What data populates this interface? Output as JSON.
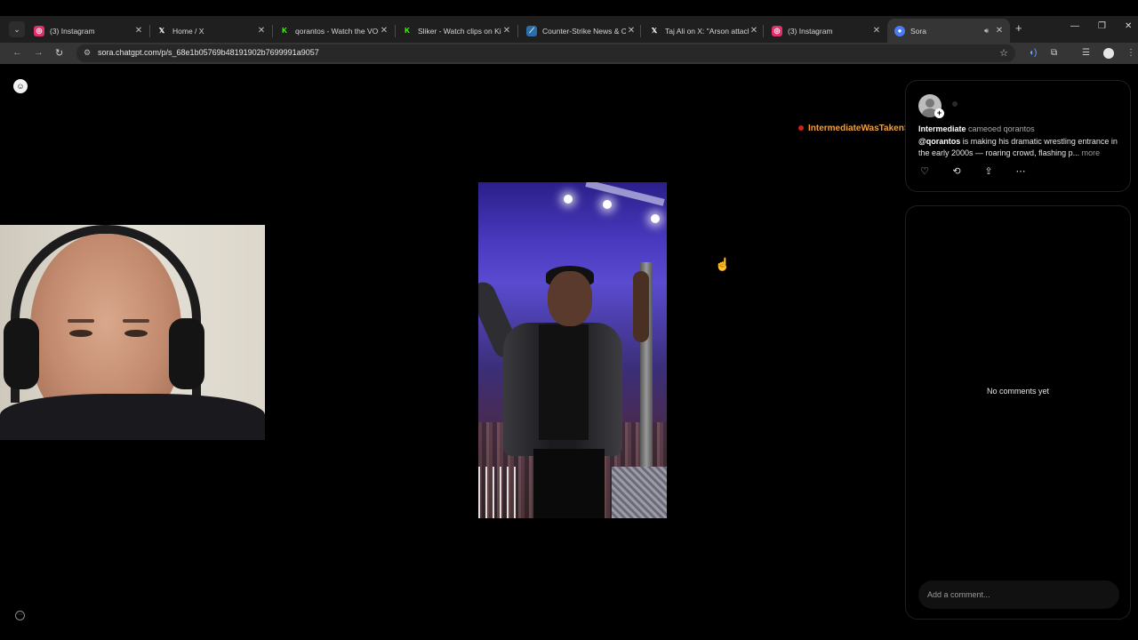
{
  "browser": {
    "tabs": [
      {
        "title": "(3) Instagram",
        "icon": "instagram-icon",
        "icon_color": "#e1306c"
      },
      {
        "title": "Home / X",
        "icon": "x-icon",
        "icon_color": "#1f1f1f"
      },
      {
        "title": "qorantos - Watch the VOD",
        "icon": "kick-icon",
        "icon_color": "#53fc18"
      },
      {
        "title": "Sliker - Watch clips on Kick",
        "icon": "kick-icon",
        "icon_color": "#53fc18"
      },
      {
        "title": "Counter-Strike News & Coverage",
        "icon": "hltv-icon",
        "icon_color": "#2b6ea8"
      },
      {
        "title": "Taj Ali on X: \"Arson attack",
        "icon": "x-icon",
        "icon_color": "#1f1f1f"
      },
      {
        "title": "(3) Instagram",
        "icon": "instagram-icon",
        "icon_color": "#e1306c"
      },
      {
        "title": "Sora",
        "icon": "sora-icon",
        "icon_color": "#4a7cf0",
        "active": true,
        "audio": true
      }
    ],
    "url": "sora.chatgpt.com/p/s_68e1b05769b48191902b7699991a9057"
  },
  "chat_overlay": {
    "username": "IntermediateWasTakenSadge"
  },
  "post": {
    "author": "Intermediate",
    "action_text": "cameoed qorantos",
    "mention": "@qorantos",
    "caption": " is making his dramatic wrestling entrance in the early 2000s — roaring crowd, flashing p...",
    "more_label": "more"
  },
  "comments": {
    "empty_text": "No comments yet",
    "input_placeholder": "Add a comment..."
  }
}
